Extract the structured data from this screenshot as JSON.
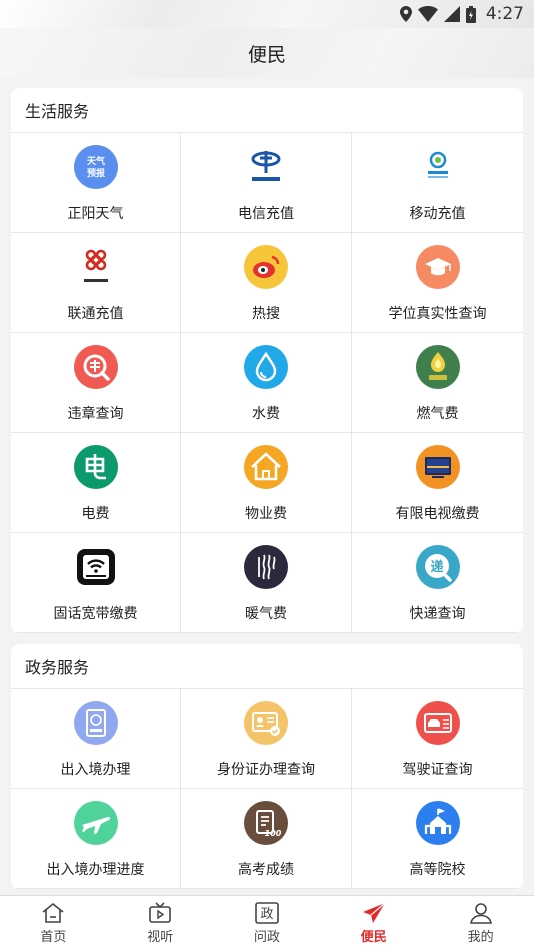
{
  "status_bar": {
    "time": "4:27"
  },
  "header": {
    "title": "便民"
  },
  "sections": [
    {
      "title": "生活服务",
      "items": [
        {
          "label": "正阳天气",
          "icon": "weather-forecast-icon",
          "color": "#5a8ff0",
          "glyph": "天气预报"
        },
        {
          "label": "电信充值",
          "icon": "china-telecom-icon",
          "color": "#ffffff",
          "glyph": ""
        },
        {
          "label": "移动充值",
          "icon": "china-mobile-icon",
          "color": "#ffffff",
          "glyph": ""
        },
        {
          "label": "联通充值",
          "icon": "china-unicom-icon",
          "color": "#ffffff",
          "glyph": ""
        },
        {
          "label": "热搜",
          "icon": "weibo-icon",
          "color": "#f7c53a",
          "glyph": ""
        },
        {
          "label": "学位真实性查询",
          "icon": "graduation-cap-icon",
          "color": "#f58a63",
          "glyph": ""
        },
        {
          "label": "违章查询",
          "icon": "traffic-violation-icon",
          "color": "#f05a52",
          "glyph": "违"
        },
        {
          "label": "水费",
          "icon": "water-drop-icon",
          "color": "#21a8e8",
          "glyph": ""
        },
        {
          "label": "燃气费",
          "icon": "gas-flame-icon",
          "color": "#3f7f4e",
          "glyph": ""
        },
        {
          "label": "电费",
          "icon": "electricity-icon",
          "color": "#0c9a6c",
          "glyph": "电"
        },
        {
          "label": "物业费",
          "icon": "property-house-icon",
          "color": "#f5a623",
          "glyph": ""
        },
        {
          "label": "有限电视缴费",
          "icon": "tv-icon",
          "color": "#f29225",
          "glyph": ""
        },
        {
          "label": "固话宽带缴费",
          "icon": "wifi-router-icon",
          "color": "#ffffff",
          "glyph": ""
        },
        {
          "label": "暖气费",
          "icon": "heating-icon",
          "color": "#2a2a3c",
          "glyph": ""
        },
        {
          "label": "快递查询",
          "icon": "express-delivery-icon",
          "color": "#39a7c7",
          "glyph": "递"
        }
      ]
    },
    {
      "title": "政务服务",
      "items": [
        {
          "label": "出入境办理",
          "icon": "passport-icon",
          "color": "#8fa8ef",
          "glyph": ""
        },
        {
          "label": "身份证办理查询",
          "icon": "id-card-icon",
          "color": "#f5c36a",
          "glyph": ""
        },
        {
          "label": "驾驶证查询",
          "icon": "driver-license-icon",
          "color": "#f0504c",
          "glyph": ""
        },
        {
          "label": "出入境办理进度",
          "icon": "airplane-icon",
          "color": "#4fd39a",
          "glyph": ""
        },
        {
          "label": "高考成绩",
          "icon": "exam-score-icon",
          "color": "#6a4e3d",
          "glyph": ""
        },
        {
          "label": "高等院校",
          "icon": "university-icon",
          "color": "#2d7ff0",
          "glyph": ""
        }
      ]
    }
  ],
  "tabs": [
    {
      "label": "首页",
      "icon": "home-icon",
      "active": false
    },
    {
      "label": "视听",
      "icon": "tv-play-icon",
      "active": false
    },
    {
      "label": "问政",
      "icon": "politics-icon",
      "active": false
    },
    {
      "label": "便民",
      "icon": "paper-plane-icon",
      "active": true
    },
    {
      "label": "我的",
      "icon": "user-icon",
      "active": false
    }
  ],
  "colors": {
    "active": "#e22a2a",
    "divider": "#e6e6e6"
  }
}
